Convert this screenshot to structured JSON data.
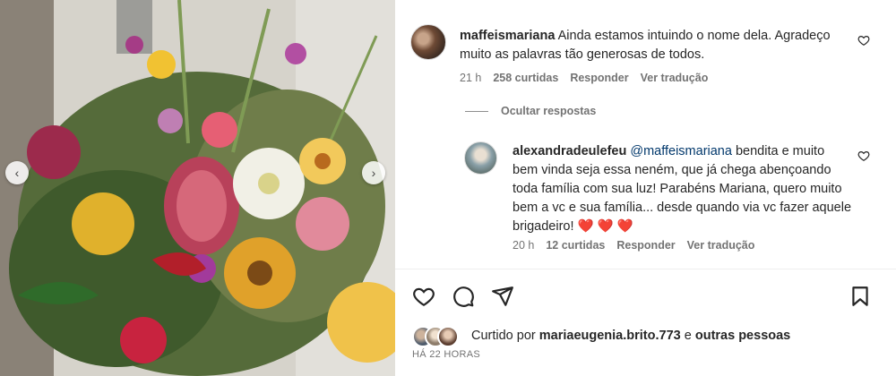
{
  "post": {
    "carousel": {
      "prev_icon": "chevron-left-icon",
      "next_icon": "chevron-right-icon"
    }
  },
  "comments": [
    {
      "username": "maffeismariana",
      "text": "Ainda estamos intuindo o nome dela. Agradeço muito as palavras tão generosas de todos.",
      "time": "21 h",
      "likes": "258 curtidas",
      "reply_label": "Responder",
      "translate_label": "Ver tradução"
    },
    {
      "username": "alexandradeulefeu",
      "mention": "@maffeismariana",
      "text": " bendita e muito bem vinda seja essa neném, que já chega abençoando toda família com sua luz! Parabéns Mariana, quero muito bem a vc e sua família... desde quando via vc fazer aquele brigadeiro! ❤️ ❤️ ❤️",
      "time": "20 h",
      "likes": "12 curtidas",
      "reply_label": "Responder",
      "translate_label": "Ver tradução"
    }
  ],
  "hide_replies_label": "Ocultar respostas",
  "liked_by": {
    "prefix": "Curtido por",
    "user": "mariaeugenia.brito.773",
    "middle": "e",
    "suffix": "outras pessoas"
  },
  "posted_ago": "HÁ 22 HORAS",
  "colors": {
    "text": "#262626",
    "muted": "#737373",
    "mention": "#00376b",
    "heart_red": "#ed1c24"
  }
}
